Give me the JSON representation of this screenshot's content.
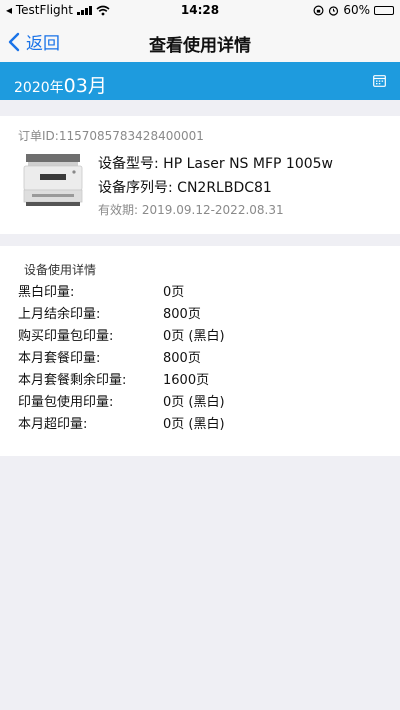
{
  "status": {
    "carrier": "◂ TestFlight",
    "time": "14:28",
    "battery": "60%",
    "battery_level": 0.6
  },
  "nav": {
    "back_label": "返回",
    "title": "查看使用详情"
  },
  "month": {
    "year": "2020",
    "year_suffix": "年",
    "month": "03",
    "month_suffix": "月"
  },
  "order": {
    "id_label": "订单ID:",
    "id": "1157085783428400001",
    "model_label": "设备型号:",
    "model": "HP Laser NS MFP 1005w",
    "serial_label": "设备序列号:",
    "serial": "CN2RLBDC81",
    "validity_label": "有效期:",
    "validity": "2019.09.12-2022.08.31"
  },
  "usage": {
    "title": "设备使用详情",
    "rows": [
      {
        "label": "黑白印量:",
        "value": "0页"
      },
      {
        "label": "上月结余印量:",
        "value": "800页"
      },
      {
        "label": "购买印量包印量:",
        "value": "0页 (黑白)"
      },
      {
        "label": "本月套餐印量:",
        "value": "800页"
      },
      {
        "label": "本月套餐剩余印量:",
        "value": "1600页"
      },
      {
        "label": "印量包使用印量:",
        "value": "0页 (黑白)"
      },
      {
        "label": "本月超印量:",
        "value": "0页 (黑白)"
      }
    ]
  },
  "colors": {
    "accent": "#1e9bde",
    "link": "#1a73e8",
    "background": "#efeff4"
  }
}
